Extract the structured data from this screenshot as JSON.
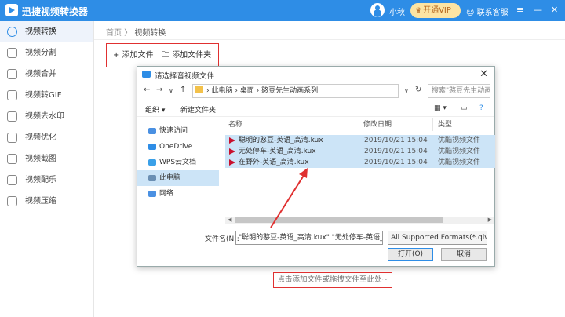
{
  "app": {
    "title": "迅捷视频转换器",
    "user": "小秋",
    "vip": "开通VIP",
    "support": "联系客服"
  },
  "sidebar": {
    "items": [
      {
        "label": "视频转换"
      },
      {
        "label": "视频分割"
      },
      {
        "label": "视频合并"
      },
      {
        "label": "视频转GIF"
      },
      {
        "label": "视频去水印"
      },
      {
        "label": "视频优化"
      },
      {
        "label": "视频截图"
      },
      {
        "label": "视频配乐"
      },
      {
        "label": "视频压缩"
      }
    ]
  },
  "breadcrumb": {
    "home": "首页",
    "sep": " 〉",
    "current": "视频转换"
  },
  "toolbar": {
    "add_file": "+ 添加文件",
    "add_folder": "添加文件夹"
  },
  "dialog": {
    "title": "请选择音视频文件",
    "path": "› 此电脑  ›  桌面  ›  憨豆先生动画系列",
    "search_placeholder": "搜索\"憨豆先生动画系列\"",
    "organize": "组织 ▾",
    "new_folder": "新建文件夹",
    "nav": [
      {
        "label": "快速访问",
        "color": "#4a90e2"
      },
      {
        "label": "OneDrive",
        "color": "#2e8de6"
      },
      {
        "label": "WPS云文档",
        "color": "#3aa0e8"
      },
      {
        "label": "此电脑",
        "color": "#6b8fb3"
      },
      {
        "label": "网络",
        "color": "#4a90e2"
      }
    ],
    "columns": {
      "name": "名称",
      "date": "修改日期",
      "type": "类型"
    },
    "files": [
      {
        "name": "聪明的憨豆-英语_高清.kux",
        "date": "2019/10/21 15:04",
        "type": "优酷视频文件"
      },
      {
        "name": "无处停车-英语_高清.kux",
        "date": "2019/10/21 15:04",
        "type": "优酷视频文件"
      },
      {
        "name": "在野外-英语_高清.kux",
        "date": "2019/10/21 15:04",
        "type": "优酷视频文件"
      }
    ],
    "filename_label": "文件名(N):",
    "filename_value": "\"聪明的憨豆-英语_高清.kux\" \"无处停车-英语_高清",
    "format": "All Supported Formats(*.qlv;",
    "open": "打开(O)",
    "cancel": "取消"
  },
  "hint": "点击添加文件或拖拽文件至此处~",
  "colors": {
    "brand": "#2e8de6",
    "highlight": "#e03030",
    "selection": "#cce4f7"
  }
}
